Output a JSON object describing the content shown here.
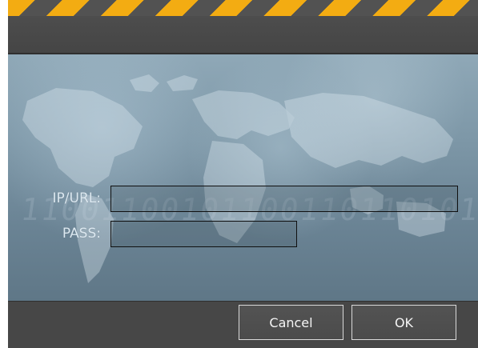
{
  "dialog": {
    "fields": {
      "ip_url": {
        "label": "IP/URL:",
        "value": ""
      },
      "pass": {
        "label": "PASS:",
        "value": ""
      }
    },
    "buttons": {
      "cancel": "Cancel",
      "ok": "OK"
    }
  },
  "theme": {
    "stripe_color": "#f3ac12",
    "panel_color": "#4a4a4a",
    "label_color": "#dce8f0"
  },
  "background": {
    "digits": "11001100101100110110101"
  }
}
